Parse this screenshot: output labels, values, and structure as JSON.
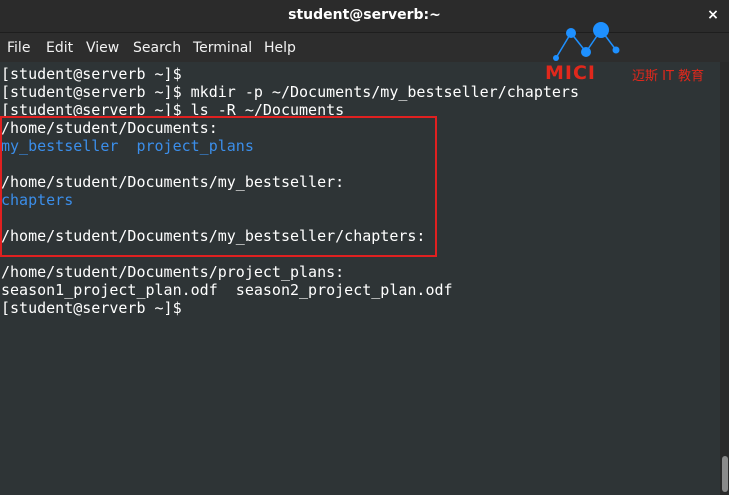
{
  "window": {
    "title": "student@serverb:~",
    "close_glyph": "×"
  },
  "menu": [
    "File",
    "Edit",
    "View",
    "Search",
    "Terminal",
    "Help"
  ],
  "terminal": {
    "lines": [
      {
        "text": "[student@serverb ~]$",
        "type": "prompt"
      },
      {
        "text": "[student@serverb ~]$ mkdir -p ~/Documents/my_bestseller/chapters",
        "type": "prompt"
      },
      {
        "text": "[student@serverb ~]$ ls -R ~/Documents",
        "type": "prompt"
      },
      {
        "text": "/home/student/Documents:",
        "type": "output"
      },
      {
        "text": "my_bestseller  project_plans",
        "type": "dir"
      },
      {
        "text": "",
        "type": "blank"
      },
      {
        "text": "/home/student/Documents/my_bestseller:",
        "type": "output"
      },
      {
        "text": "chapters",
        "type": "dir"
      },
      {
        "text": "",
        "type": "blank"
      },
      {
        "text": "/home/student/Documents/my_bestseller/chapters:",
        "type": "output"
      },
      {
        "text": "",
        "type": "blank"
      },
      {
        "text": "/home/student/Documents/project_plans:",
        "type": "output"
      },
      {
        "text": "season1_project_plan.odf  season2_project_plan.odf",
        "type": "output"
      },
      {
        "text": "[student@serverb ~]$",
        "type": "prompt"
      }
    ]
  },
  "watermark": {
    "brand": "MICI",
    "subtitle": "迈斯 IT 教育",
    "color": "#e0281c",
    "node_color": "#1e90ff"
  },
  "colors": {
    "background": "#2e3436",
    "directory": "#3b8eea",
    "highlight": "#e02020"
  }
}
